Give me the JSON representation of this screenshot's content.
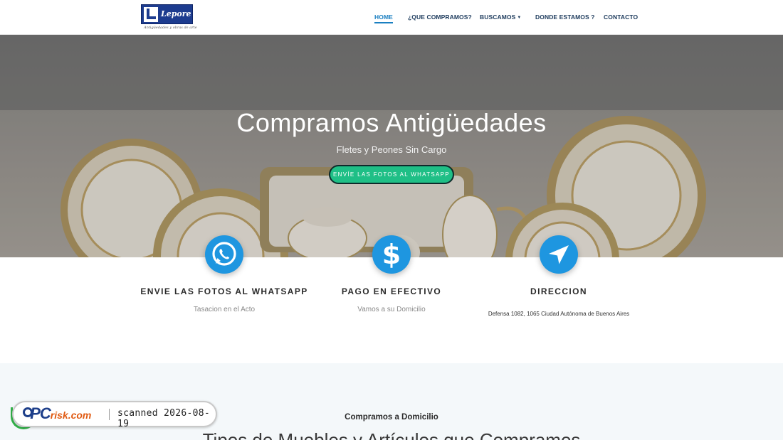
{
  "header": {
    "logo_text": "Lepore",
    "logo_tagline": "Antigüedades y obras de arte",
    "nav": [
      {
        "label": "HOME",
        "active": true
      },
      {
        "label": "¿QUE COMPRAMOS?",
        "active": false
      },
      {
        "label": "BUSCAMOS",
        "active": false,
        "dropdown": true
      },
      {
        "label": "DONDE ESTAMOS ?",
        "active": false
      },
      {
        "label": "CONTACTO",
        "active": false
      }
    ]
  },
  "hero": {
    "title": "Compramos Antigüedades",
    "subtitle": "Fletes y Peones Sin Cargo",
    "button": "ENVÍE LAS FOTOS AL WHATSAPP"
  },
  "features": [
    {
      "icon": "whatsapp-icon",
      "title": "ENVIE LAS FOTOS AL WHATSAPP",
      "text": "Tasacion en el Acto"
    },
    {
      "icon": "dollar-icon",
      "title": "PAGO EN EFECTIVO",
      "text": "Vamos a su Domicilio"
    },
    {
      "icon": "location-arrow-icon",
      "title": "DIRECCION",
      "text": "Defensa 1082, 1065 Ciudad Autónoma de Buenos Aires"
    }
  ],
  "section": {
    "subtitle": "Compramos a Domicilio",
    "title": "Tipos de Muebles y Artículos que Compramos"
  },
  "badge": {
    "logo": "PC",
    "logo_suffix": "risk.com",
    "text": "scanned 2026-08-19"
  },
  "colors": {
    "accent": "#1e96e0",
    "nav_active": "#1a7fc1",
    "button": "#1fbf86",
    "section_bg": "#f4f8fa"
  }
}
